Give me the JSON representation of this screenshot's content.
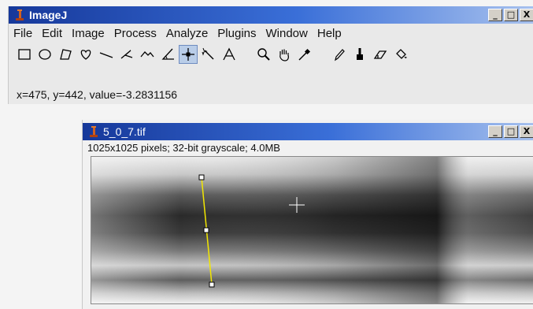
{
  "app": {
    "title": "ImageJ",
    "window_controls": [
      "_",
      "□",
      "X"
    ],
    "menus": [
      "File",
      "Edit",
      "Image",
      "Process",
      "Analyze",
      "Plugins",
      "Window",
      "Help"
    ],
    "tools": [
      "rectangle-selection",
      "oval-selection",
      "polygon-selection",
      "freehand-selection",
      "straight-line",
      "segmented-line",
      "freehand-line",
      "angle",
      "point",
      "wand",
      "text",
      "magnifier",
      "hand-scroll",
      "color-picker",
      "pencil",
      "brush",
      "eraser",
      "flood-fill"
    ],
    "active_tool": "point",
    "status": "x=475, y=442, value=-3.2831156"
  },
  "image_window": {
    "title": "5_0_7.tif",
    "info": "1025x1025 pixels; 32-bit grayscale; 4.0MB"
  },
  "colors": {
    "titlebar_start": "#16389a",
    "titlebar_end": "#a7c1ee",
    "selection_line": "#f2e600"
  }
}
